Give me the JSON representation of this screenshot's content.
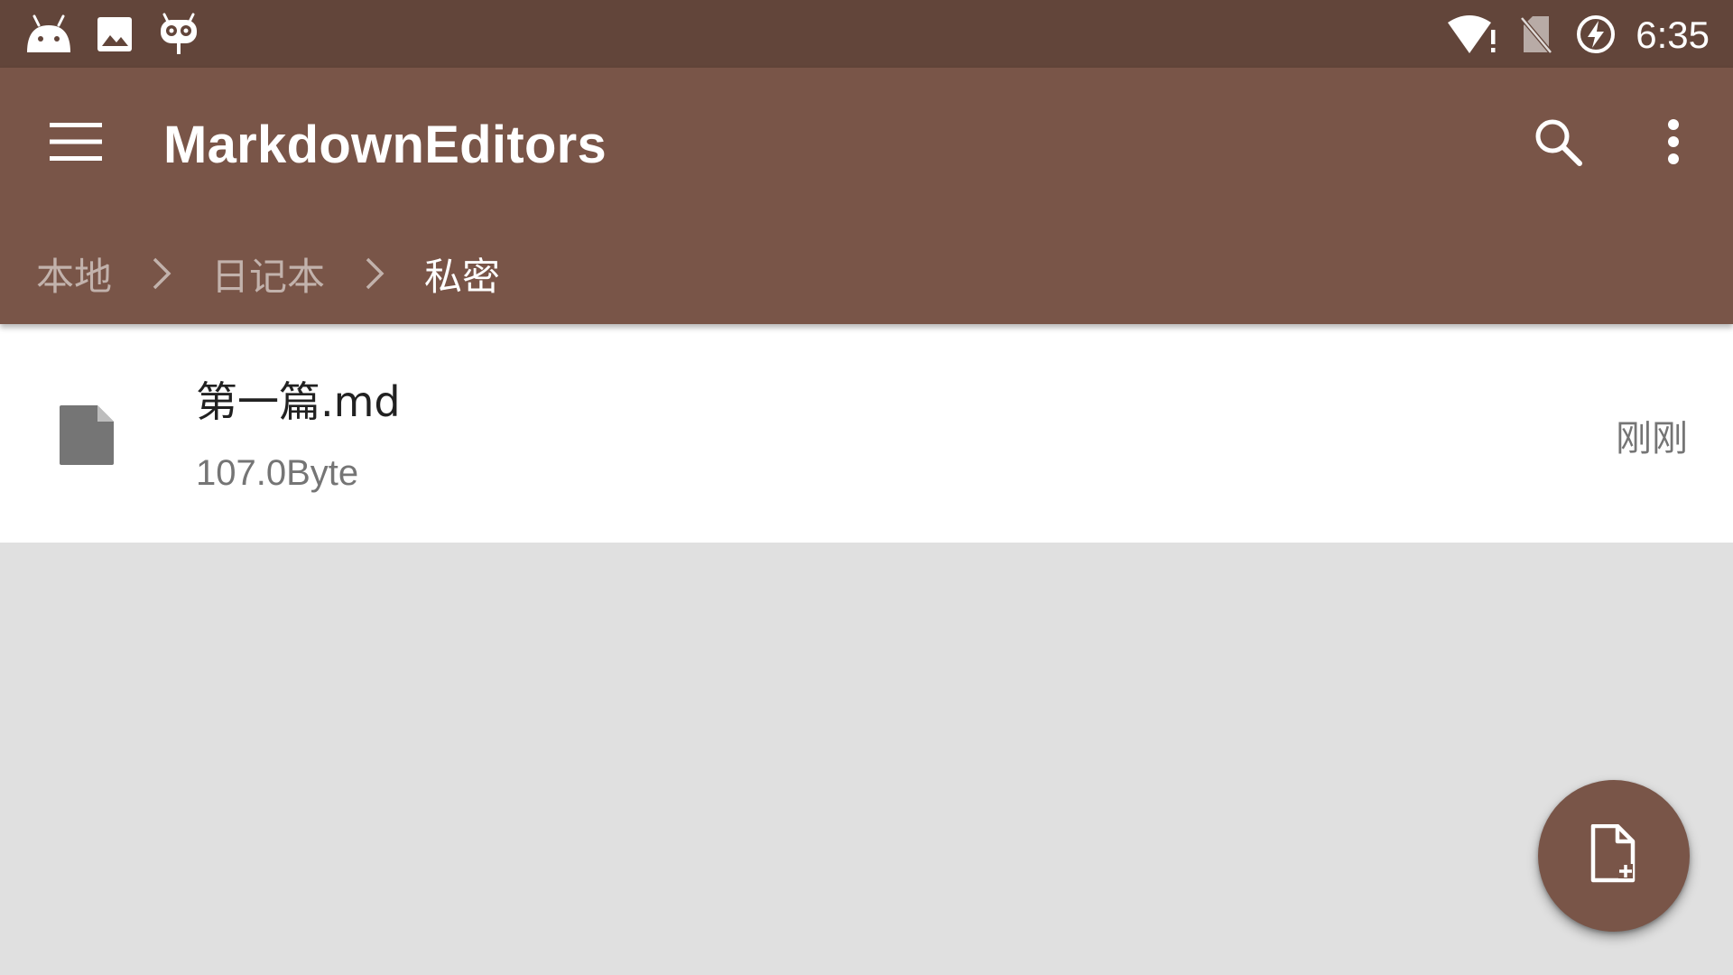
{
  "status_bar": {
    "time": "6:35",
    "left_icons": [
      "android-icon",
      "image-icon",
      "cyanogen-mascot-icon"
    ],
    "right_icons": [
      "wifi-alert-icon",
      "no-sim-icon",
      "battery-charging-icon"
    ]
  },
  "toolbar": {
    "title": "MarkdownEditors",
    "menu_icon": "menu-icon",
    "search_icon": "search-icon",
    "more_icon": "more-vert-icon"
  },
  "breadcrumb": {
    "items": [
      "本地",
      "日记本",
      "私密"
    ]
  },
  "files": [
    {
      "name": "第一篇.md",
      "size": "107.0Byte",
      "time": "刚刚",
      "icon": "file-icon"
    }
  ],
  "fab": {
    "icon": "new-file-icon"
  },
  "colors": {
    "status_bar": "#62453a",
    "primary": "#795548",
    "background": "#e0e0e0",
    "file_icon": "#757575"
  }
}
